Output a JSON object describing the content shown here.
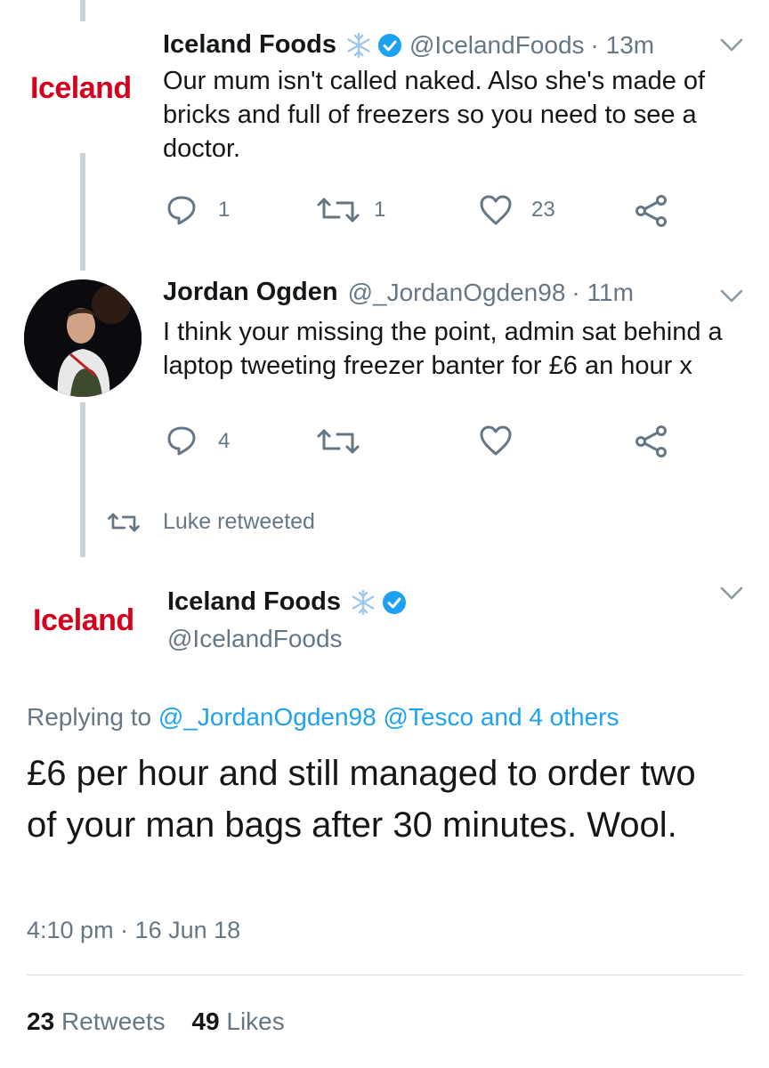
{
  "colors": {
    "accent": "#1da1f2",
    "text_secondary": "#657786",
    "iceland_red": "#d6001c",
    "thread_line": "#c8d2da"
  },
  "tweet1": {
    "name": "Iceland Foods",
    "handle": "@IcelandFoods",
    "time": "· 13m",
    "avatar_text": "Iceland",
    "text": "Our mum isn't called naked. Also she's made of bricks and full of freezers so you need to see a doctor.",
    "replies": "1",
    "retweets": "1",
    "likes": "23"
  },
  "tweet2": {
    "name": "Jordan Ogden",
    "handle": "@_JordanOgden98",
    "time": "· 11m",
    "text": "I think your missing the point, admin sat behind a laptop tweeting freezer banter for £6 an hour x",
    "replies": "4"
  },
  "retweeted_by": "Luke retweeted",
  "main_tweet": {
    "name": "Iceland Foods",
    "handle": "@IcelandFoods",
    "avatar_text": "Iceland",
    "replying_prefix": "Replying to",
    "replying_handles": "@_JordanOgden98 @Tesco and 4 others",
    "text": "£6 per hour and still managed to order two of your man bags after 30 minutes. Wool.",
    "timestamp": "4:10 pm · 16 Jun 18",
    "retweets_count": "23",
    "retweets_label": "Retweets",
    "likes_count": "49",
    "likes_label": "Likes"
  },
  "icons": [
    "snowflake-icon",
    "verified-badge-icon",
    "chevron-down-icon",
    "reply-icon",
    "retweet-icon",
    "like-icon",
    "share-icon"
  ]
}
